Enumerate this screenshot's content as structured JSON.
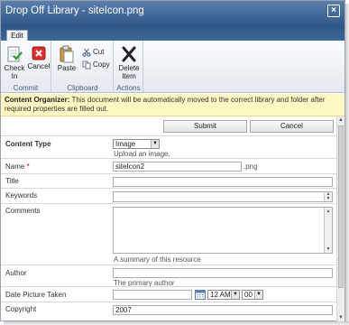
{
  "window": {
    "title": "Drop Off Library - siteIcon.png"
  },
  "ribbon": {
    "tabs": [
      {
        "label": "Edit"
      }
    ],
    "commit": {
      "label": "Commit",
      "check_in": "Check In",
      "cancel": "Cancel"
    },
    "clipboard": {
      "label": "Clipboard",
      "paste": "Paste",
      "cut": "Cut",
      "copy": "Copy"
    },
    "actions": {
      "label": "Actions",
      "delete_item": "Delete Item"
    }
  },
  "notice": {
    "heading": "Content Organizer:",
    "text": " This document will be automatically moved to the correct library and folder after required properties are filled out."
  },
  "form": {
    "submit_label": "Submit",
    "cancel_label": "Cancel",
    "content_type": {
      "label": "Content Type",
      "value": "Image",
      "hint": "Upload an image."
    },
    "name": {
      "label": "Name",
      "required_mark": "*",
      "value": "siteIcon2",
      "suffix": ".png"
    },
    "title": {
      "label": "Title",
      "value": ""
    },
    "keywords": {
      "label": "Keywords",
      "value": ""
    },
    "comments": {
      "label": "Comments",
      "value": "",
      "hint": "A summary of this resource"
    },
    "author": {
      "label": "Author",
      "value": "",
      "hint": "The primary author"
    },
    "date_picture_taken": {
      "label": "Date Picture Taken",
      "value": "",
      "hour": "12 AM",
      "minute": "00"
    },
    "copyright": {
      "label": "Copyright",
      "value": "2007"
    }
  },
  "colors": {
    "titlebar": "#2f5686",
    "notice_bg": "#fff7c2",
    "required": "#bf0000"
  }
}
